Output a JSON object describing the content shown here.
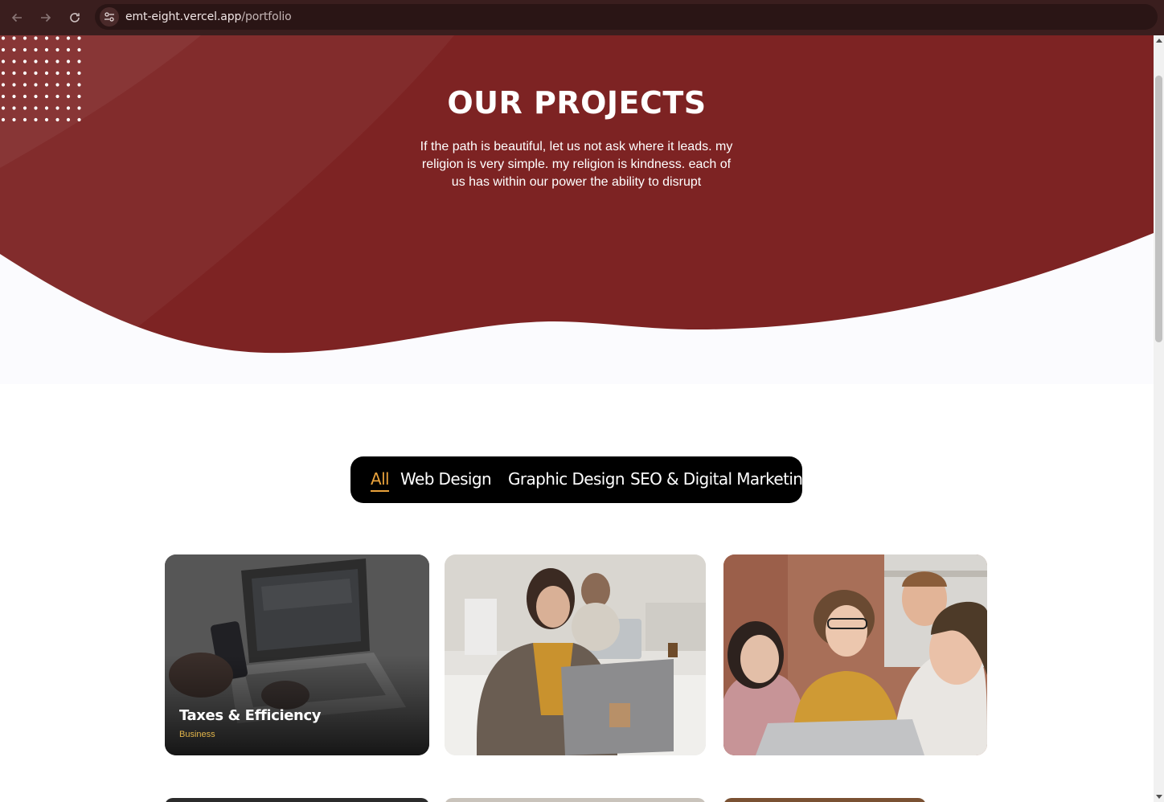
{
  "browser": {
    "url_host": "emt-eight.vercel.app",
    "url_path": "/portfolio",
    "back_icon": "arrow-left-icon",
    "forward_icon": "arrow-right-icon",
    "reload_icon": "reload-icon",
    "site_info_icon": "tune-icon"
  },
  "hero": {
    "title": "OUR PROJECTS",
    "text": "If the path is beautiful, let us not ask where it leads. my religion is very simple. my religion is kindness. each of us has within our power the ability to disrupt",
    "background_color": "#7d2323"
  },
  "filters": [
    {
      "label": "All",
      "active": true
    },
    {
      "label": "Web Design",
      "active": false
    },
    {
      "label": "Graphic Design",
      "active": false
    },
    {
      "label": "SEO & Digital Marketing",
      "active": false
    }
  ],
  "accent_color": "#e9a23b",
  "projects": [
    {
      "title": "Taxes & Efficiency",
      "category": "Business",
      "image": "laptop-phone-photo"
    },
    {
      "title": "",
      "category": "",
      "image": "woman-working-on-laptop-photo"
    },
    {
      "title": "",
      "category": "",
      "image": "team-looking-at-laptop-photo"
    }
  ]
}
